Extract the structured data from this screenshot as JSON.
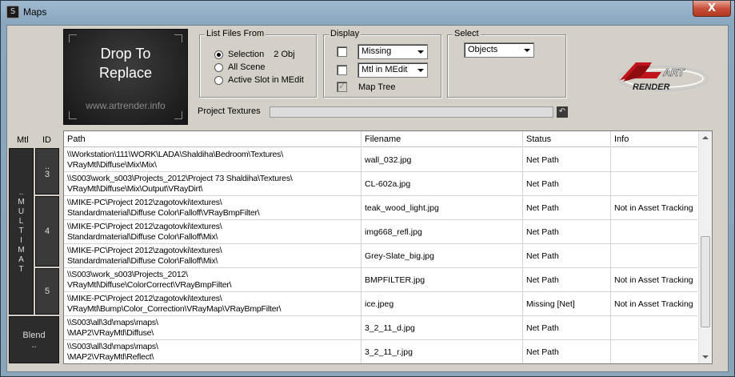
{
  "window": {
    "title": "Maps",
    "app_icon": "3ds-max-icon",
    "close_label": "X"
  },
  "drop_tile": {
    "line1": "Drop To",
    "line2": "Replace",
    "url": "www.artrender.info"
  },
  "list_files_from": {
    "title": "List Files From",
    "options": [
      "Selection",
      "All Scene",
      "Active Slot in MEdit"
    ],
    "selected_index": 0,
    "selection_count": "2 Obj"
  },
  "display": {
    "title": "Display",
    "row1": {
      "checked": false,
      "dropdown": "Missing"
    },
    "row2": {
      "checked": false,
      "dropdown": "Mtl in MEdit"
    },
    "row3": {
      "checked": true,
      "label": "Map Tree"
    }
  },
  "select": {
    "title": "Select",
    "dropdown": "Objects"
  },
  "logo": {
    "text": "ART",
    "subtext": "RENDER"
  },
  "project_textures": {
    "label": "Project Textures",
    "refresh_icon": "back-arrow-icon"
  },
  "left_columns": {
    "mtl_header": "Mtl",
    "id_header": "ID",
    "mtl_group_label": "MULTIMAT",
    "mtl_group_marker": "..",
    "ids": [
      {
        "marker": "..",
        "value": "3"
      },
      {
        "marker": "",
        "value": "4"
      },
      {
        "marker": "",
        "value": "5"
      }
    ],
    "blend_label": "Blend",
    "blend_marker": ".."
  },
  "table": {
    "headers": [
      "Path",
      "Filename",
      "Status",
      "Info"
    ],
    "rows": [
      {
        "path": "\\\\Workstation\\111\\WORK\\LADA\\Shaldiha\\Bedroom\\Textures\\\nVRayMtl\\Diffuse\\Mix\\Mix\\",
        "filename": "wall_032.jpg",
        "status": "Net Path",
        "info": ""
      },
      {
        "path": "\\\\S003\\work_s003\\Projects_2012\\Project 73 Shaldiha\\Textures\\\nVRayMtl\\Diffuse\\Mix\\Output\\VRayDirt\\",
        "filename": "CL-602a.jpg",
        "status": "Net Path",
        "info": ""
      },
      {
        "path": "\\\\MIKE-PC\\Project 2012\\zagotovki\\textures\\\nStandardmaterial\\Diffuse Color\\Falloff\\VRayBmpFilter\\",
        "filename": "teak_wood_light.jpg",
        "status": "Net Path",
        "info": "Not in Asset Tracking"
      },
      {
        "path": "\\\\MIKE-PC\\Project 2012\\zagotovki\\textures\\\nStandardmaterial\\Diffuse Color\\Falloff\\Mix\\",
        "filename": "img668_refl.jpg",
        "status": "Net Path",
        "info": ""
      },
      {
        "path": "\\\\MIKE-PC\\Project 2012\\zagotovki\\textures\\\nStandardmaterial\\Diffuse Color\\Falloff\\Mix\\",
        "filename": "Grey-Slate_big.jpg",
        "status": "Net Path",
        "info": ""
      },
      {
        "path": "\\\\S003\\work_s003\\Projects_2012\\\nVRayMtl\\Diffuse\\ColorCorrect\\VRayBmpFilter\\",
        "filename": "BMPFILTER.jpg",
        "status": "Net Path",
        "info": "Not in Asset Tracking"
      },
      {
        "path": "\\\\MIKE-PC\\Project 2012\\zagotovki\\textures\\\nVRayMtl\\Bump\\Color_Correction\\VRayMap\\VRayBmpFilter\\",
        "filename": "ice.jpeg",
        "status": "Missing [Net]",
        "info": "Not in Asset Tracking"
      },
      {
        "path": "\\\\S003\\all\\3d\\maps\\maps\\\n\\MAP2\\VRayMtl\\Diffuse\\",
        "filename": "3_2_11_d.jpg",
        "status": "Net Path",
        "info": ""
      },
      {
        "path": "\\\\S003\\all\\3d\\maps\\maps\\\n\\MAP2\\VRayMtl\\Reflect\\",
        "filename": "3_2_11_r.jpg",
        "status": "Net Path",
        "info": ""
      }
    ]
  },
  "colors": {
    "dark_tile": "#2c2c2c",
    "dialog_bg": "#d4d0c8",
    "close_red": "#c7503b"
  }
}
